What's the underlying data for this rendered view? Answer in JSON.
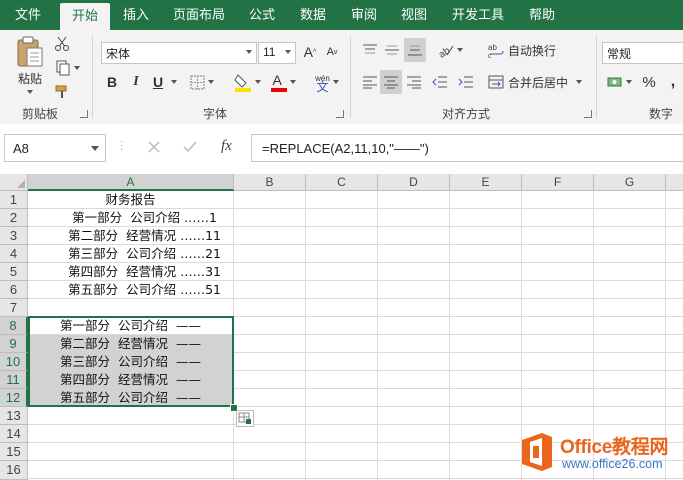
{
  "menu": {
    "tabs": [
      "文件",
      "开始",
      "插入",
      "页面布局",
      "公式",
      "数据",
      "审阅",
      "视图",
      "开发工具",
      "帮助"
    ],
    "active": "开始"
  },
  "ribbon": {
    "clipboard": {
      "paste_label": "粘贴",
      "group_label": "剪贴板"
    },
    "font": {
      "font_name": "宋体",
      "font_size": "11",
      "bold": "B",
      "italic": "I",
      "underline": "U",
      "phonetic": "wén",
      "group_label": "字体"
    },
    "alignment": {
      "wrap_text": "自动换行",
      "merge_center": "合并后居中",
      "group_label": "对齐方式"
    },
    "number": {
      "format": "常规",
      "group_label": "数字"
    }
  },
  "formula_bar": {
    "name_box": "A8",
    "fx_label": "fx",
    "formula": "=REPLACE(A2,11,10,\"——\")"
  },
  "sheet": {
    "columns": [
      "A",
      "B",
      "C",
      "D",
      "E",
      "F",
      "G"
    ],
    "rows": [
      "1",
      "2",
      "3",
      "4",
      "5",
      "6",
      "7",
      "8",
      "9",
      "10",
      "11",
      "12",
      "13",
      "14",
      "15",
      "16"
    ],
    "cells": {
      "A1": "财务报告",
      "A2": "第一部分  公司介绍 ……1",
      "A3": "第二部分  经营情况 ……11",
      "A4": "第三部分  公司介绍 ……21",
      "A5": "第四部分  经营情况 ……31",
      "A6": "第五部分  公司介绍 ……51",
      "A8": "第一部分  公司介绍  ——",
      "A9": "第二部分  经营情况  ——",
      "A10": "第三部分  公司介绍  ——",
      "A11": "第四部分  经营情况  ——",
      "A12": "第五部分  公司介绍  ——"
    }
  },
  "watermark": {
    "title": "Office教程网",
    "url": "www.office26.com"
  },
  "colors": {
    "accent": "#217346",
    "watermark_orange": "#e9661c",
    "watermark_blue": "#3a78c8"
  }
}
